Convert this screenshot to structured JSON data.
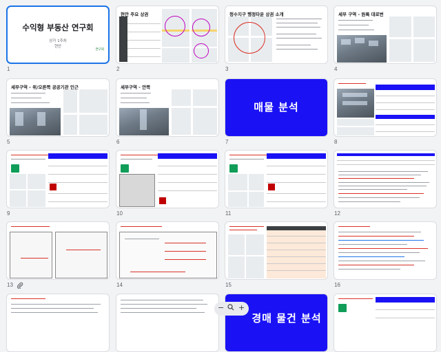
{
  "slides": [
    {
      "num": "1",
      "title": "수익형 부동산 연구회",
      "sub1": "상가 1주차",
      "sub2": "현안",
      "tag": "연구회"
    },
    {
      "num": "2",
      "title": "현안 주요 상권"
    },
    {
      "num": "3",
      "title": "청수지구 행정타운 상권 소개"
    },
    {
      "num": "4",
      "title": "세부 구역 - 원룩 대로변"
    },
    {
      "num": "5",
      "title": "세부구역 - 위/오른쪽 공공기관 인근"
    },
    {
      "num": "6",
      "title": "세부구역 - 안쪽"
    },
    {
      "num": "7",
      "title": "매물 분석"
    },
    {
      "num": "8"
    },
    {
      "num": "9"
    },
    {
      "num": "10"
    },
    {
      "num": "11"
    },
    {
      "num": "12"
    },
    {
      "num": "13"
    },
    {
      "num": "14"
    },
    {
      "num": "15"
    },
    {
      "num": "16"
    },
    {
      "title_partial": "경매 물건 분석"
    }
  ],
  "zoom": {
    "minus": "−",
    "plus": "+"
  }
}
